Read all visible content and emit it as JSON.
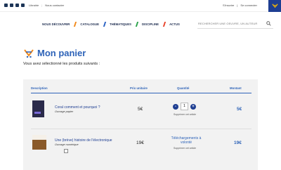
{
  "topbar": {
    "links": [
      "Librairie",
      "Nous contacter"
    ],
    "account_links": [
      "S'inscrire",
      "Se connecter"
    ]
  },
  "icons": {
    "social": [
      "facebook-icon",
      "twitter-icon",
      "youtube-icon",
      "linkedin-icon"
    ],
    "cart": "cart-icon",
    "search": "search-icon"
  },
  "nav": {
    "items": [
      "NOUS DÉCOUVRIR",
      "CATALOGUE",
      "THÉMATIQUES",
      "DISCIPLINE",
      "ACTUS"
    ]
  },
  "search": {
    "placeholder": "RECHERCHER UNE OEUVRE, UN AUTEUR"
  },
  "page": {
    "title": "Mon panier",
    "subtitle": "Vous avez sélectionné les produits suivants :"
  },
  "table": {
    "headers": {
      "description": "Description",
      "price": "Prix unitaire",
      "quantity": "Quantité",
      "amount": "Montant"
    },
    "rows": [
      {
        "title": "Coral comment et pourquoi ?",
        "type": "Ouvrage papier",
        "price": "5€",
        "quantity": "1",
        "remove": "Supprimer cet article",
        "amount": "5€"
      },
      {
        "title": "Une (brève) histoire de l'électronique",
        "type": "Ouvrage numérique",
        "price": "19€",
        "download": "Téléchargements à volonté",
        "remove": "Supprimer cet article",
        "amount": "19€"
      }
    ]
  },
  "colors": {
    "primary_blue": "#2e63b8",
    "navy": "#1e3e92",
    "nav_accents": [
      "#f28a1a",
      "#2b63c4",
      "#2aa24a",
      "#e8452c"
    ]
  }
}
